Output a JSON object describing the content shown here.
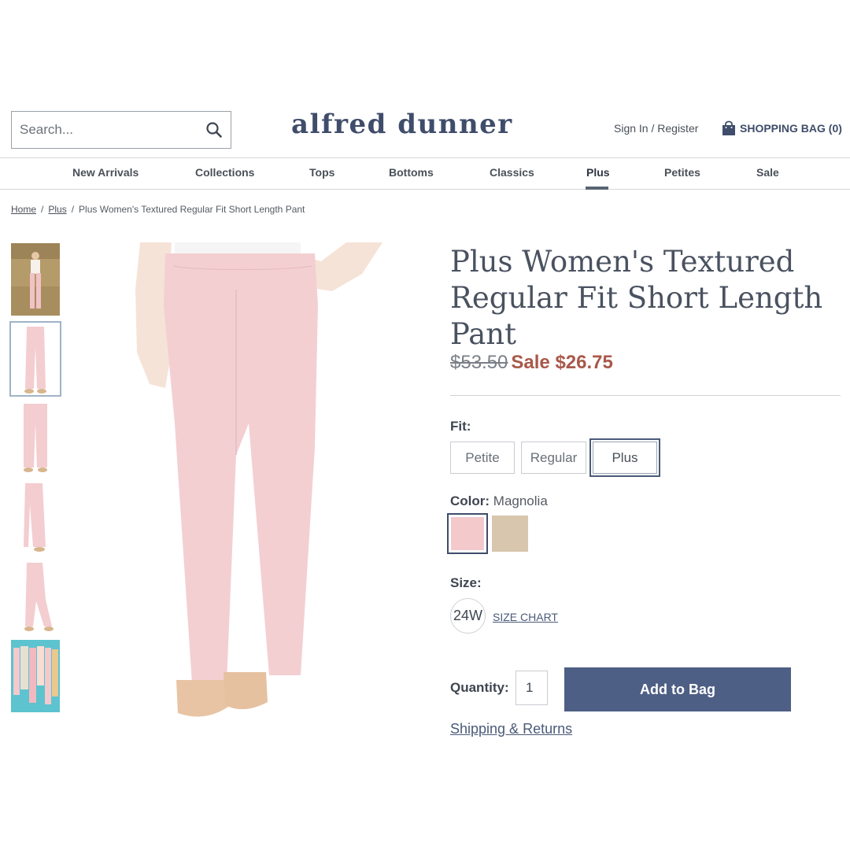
{
  "header": {
    "search_placeholder": "Search...",
    "logo": "alfred dunner",
    "signin": "Sign In / Register",
    "bag_label": "SHOPPING BAG (0)"
  },
  "nav": {
    "items": [
      "New Arrivals",
      "Collections",
      "Tops",
      "Bottoms",
      "Classics",
      "Plus",
      "Petites",
      "Sale"
    ],
    "active": "Plus"
  },
  "breadcrumb": {
    "home": "Home",
    "category": "Plus",
    "current": "Plus Women's Textured Regular Fit Short Length Pant"
  },
  "product": {
    "title": "Plus Women's Textured Regular Fit Short Length Pant",
    "original_price": "$53.50",
    "sale_price": "Sale $26.75",
    "fit_label": "Fit:",
    "fit_options": [
      "Petite",
      "Regular",
      "Plus"
    ],
    "fit_selected": "Plus",
    "color_label": "Color:",
    "color_value": "Magnolia",
    "colors": [
      {
        "name": "Magnolia",
        "hex": "#f3c9cc"
      },
      {
        "name": "Tan",
        "hex": "#d9c6ae"
      }
    ],
    "size_label": "Size:",
    "size_value": "24W",
    "size_chart": "SIZE CHART",
    "quantity_label": "Quantity:",
    "quantity_value": "1",
    "add_to_bag": "Add to Bag",
    "shipping_link": "Shipping & Returns"
  },
  "colors": {
    "brand": "#3f4d6a",
    "sale": "#a9584a",
    "button": "#4e5f85",
    "pant_pink": "#f3cfd2"
  }
}
